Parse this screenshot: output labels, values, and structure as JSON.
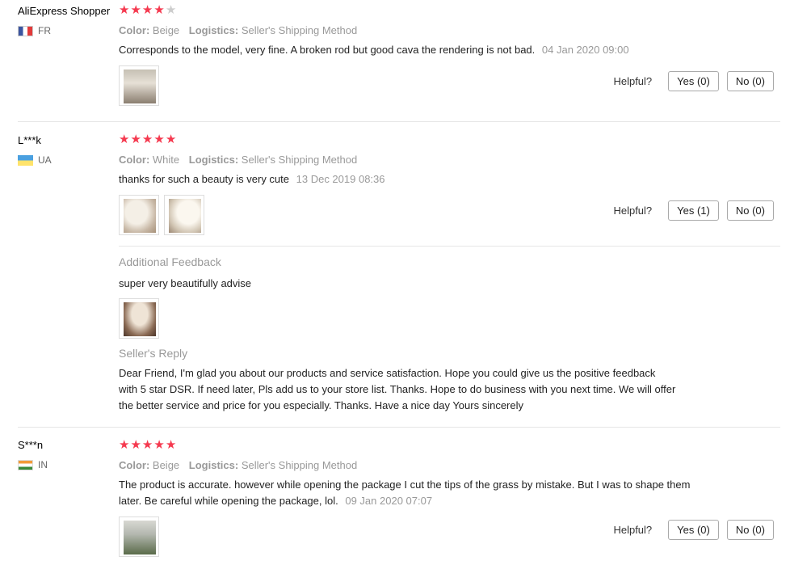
{
  "labels": {
    "color": "Color:",
    "logistics": "Logistics:",
    "helpful": "Helpful?",
    "additional_feedback": "Additional Feedback",
    "sellers_reply": "Seller's Reply"
  },
  "reviews": [
    {
      "user": "AliExpress Shopper",
      "country": "FR",
      "rating": 4,
      "color": "Beige",
      "logistics": "Seller's Shipping Method",
      "text": "Corresponds to the model, very fine. A broken rod but good cava the rendering is not bad.",
      "date": "04 Jan 2020 09:00",
      "yes": "Yes (0)",
      "no": "No (0)"
    },
    {
      "user": "L***k",
      "country": "UA",
      "rating": 5,
      "color": "White",
      "logistics": "Seller's Shipping Method",
      "text": "thanks for such a beauty is very cute",
      "date": "13 Dec 2019 08:36",
      "yes": "Yes (1)",
      "no": "No (0)",
      "additional_feedback": "super very beautifully advise",
      "seller_reply": "Dear Friend, I'm glad you about our products and service satisfaction. Hope you could give us the positive feedback with 5 star DSR. If need later, Pls add us to your store list. Thanks. Hope to do business with you next time. We will offer the better service and price for you especially. Thanks. Have a nice day Yours sincerely"
    },
    {
      "user": "S***n",
      "country": "IN",
      "rating": 5,
      "color": "Beige",
      "logistics": "Seller's Shipping Method",
      "text": "The product is accurate. however while opening the package I cut the tips of the grass by mistake. But I was to shape them later. Be careful while opening the package, lol.",
      "date": "09 Jan 2020 07:07",
      "yes": "Yes (0)",
      "no": "No (0)"
    }
  ],
  "colors": {
    "star": "#f5394f",
    "star_off": "#cccccc",
    "muted": "#999999",
    "divider": "#e6e6e6"
  }
}
